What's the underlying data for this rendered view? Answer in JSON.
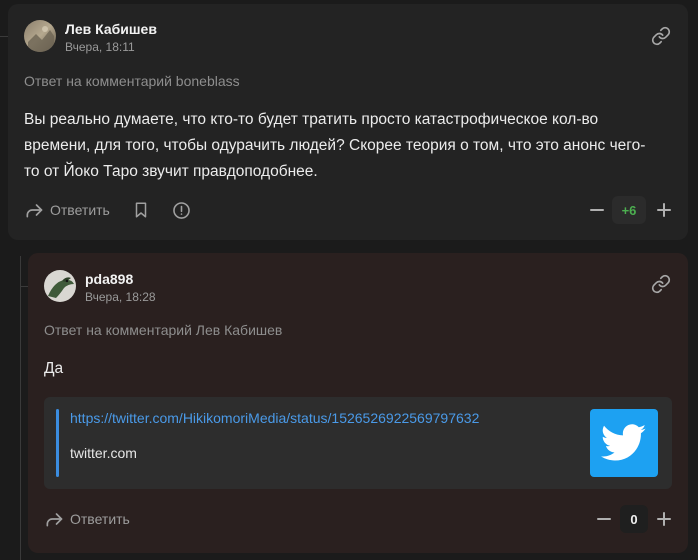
{
  "comment1": {
    "author": "Лев Кабишев",
    "time": "Вчера, 18:11",
    "reply_to": "Ответ на комментарий boneblass",
    "text_lines": [
      "Вы реально думаете, что кто-то будет тратить просто катастрофическое кол-во",
      "времени, для того, чтобы одурачить людей? Скорее теория о том, что это анонс чего-",
      "то от Йоко Таро звучит правдоподобнее."
    ],
    "reply_label": "Ответить",
    "score": "+6",
    "score_color": "#4caf50"
  },
  "comment2": {
    "author": "pda898",
    "time": "Вчера, 18:28",
    "reply_to": "Ответ на комментарий Лев Кабишев",
    "text": "Да",
    "embed": {
      "url": "https://twitter.com/HikikomoriMedia/status/1526526922569797632",
      "domain": "twitter.com",
      "thumb_icon": "twitter-bird-icon"
    },
    "reply_label": "Ответить",
    "score": "0"
  },
  "icons": {
    "link": "link-icon",
    "reply": "reply-arrow-icon",
    "bookmark": "bookmark-icon",
    "report": "alert-circle-icon",
    "minus": "minus-icon",
    "plus": "plus-icon"
  },
  "colors": {
    "accent_link": "#4a9ae8",
    "twitter_blue": "#1da1f2",
    "positive": "#4caf50"
  }
}
